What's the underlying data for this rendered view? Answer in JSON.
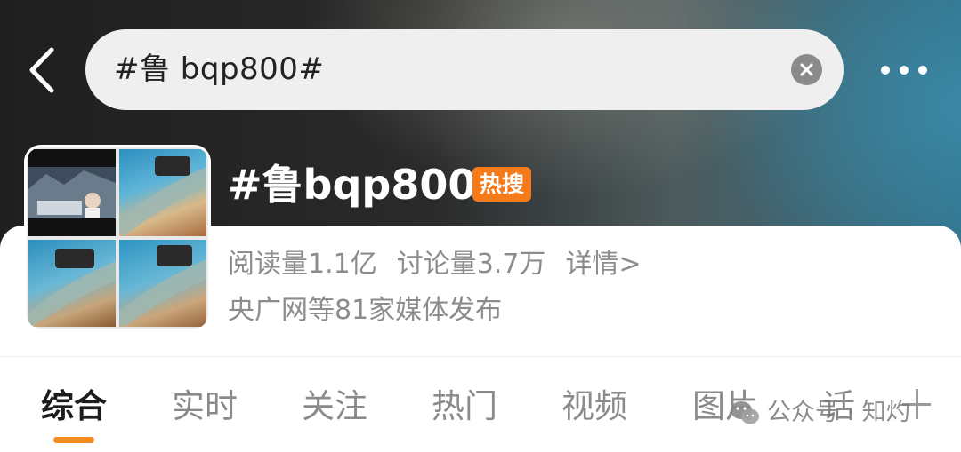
{
  "search": {
    "query": "#鲁 bqp800#"
  },
  "topic": {
    "title": "#鲁bqp800#",
    "badge": "热搜",
    "reads": "阅读量1.1亿",
    "discussions": "讨论量3.7万",
    "detail_link": "详情>",
    "sources": "央广网等81家媒体发布"
  },
  "tabs": [
    {
      "label": "综合",
      "active": true
    },
    {
      "label": "实时",
      "active": false
    },
    {
      "label": "关注",
      "active": false
    },
    {
      "label": "热门",
      "active": false
    },
    {
      "label": "视频",
      "active": false
    },
    {
      "label": "图片",
      "active": false
    },
    {
      "label": "话",
      "active": false
    }
  ],
  "watermark": {
    "text": "公众号 · 知灼"
  },
  "colors": {
    "hot_badge": "#f47a1a",
    "tab_indicator": "#f28c1e",
    "active_tab_text": "#1c1c1c",
    "inactive_tab_text": "#8a8a8a"
  },
  "icons": {
    "back": "chevron-left-icon",
    "clear": "clear-icon",
    "more": "more-dots-icon",
    "tabs_more": "plus-icon",
    "watermark": "wechat-icon"
  }
}
